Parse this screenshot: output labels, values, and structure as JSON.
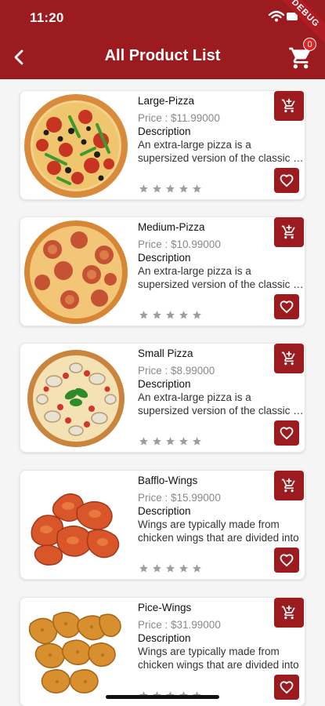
{
  "status_bar": {
    "time": "11:20",
    "debug_label": "DEBUG"
  },
  "header": {
    "title": "All Product List",
    "cart_count": "0"
  },
  "colors": {
    "primary": "#9b1b1f",
    "badge": "#e02323",
    "star": "#9e9e9e"
  },
  "products": [
    {
      "name": "Large-Pizza",
      "price": "Price : $11.99000",
      "desc_label": "Description",
      "desc_line1": "An extra-large pizza is a",
      "desc_line2": "supersized version of the classic pizza",
      "image_icon": "pizza-pepperoni-image",
      "rating": 0
    },
    {
      "name": "Medium-Pizza",
      "price": "Price : $10.99000",
      "desc_label": "Description",
      "desc_line1": "An extra-large pizza is a",
      "desc_line2": "supersized version of the classic pizza",
      "image_icon": "pizza-salami-image",
      "rating": 0
    },
    {
      "name": "Small Pizza",
      "price": "Price : $8.99000",
      "desc_label": "Description",
      "desc_line1": "An extra-large pizza is a",
      "desc_line2": "supersized version of the classic pizza",
      "image_icon": "pizza-mushroom-image",
      "rating": 0
    },
    {
      "name": "Bafflo-Wings",
      "price": "Price : $15.99000",
      "desc_label": "Description",
      "desc_line1": "Wings are typically made from",
      "desc_line2": "chicken wings that are divided into",
      "image_icon": "chicken-wings-image",
      "rating": 0
    },
    {
      "name": "Pice-Wings",
      "price": "Price : $31.99000",
      "desc_label": "Description",
      "desc_line1": "Wings are typically made from",
      "desc_line2": "chicken wings that are divided into",
      "image_icon": "fried-wings-image",
      "rating": 0
    }
  ]
}
